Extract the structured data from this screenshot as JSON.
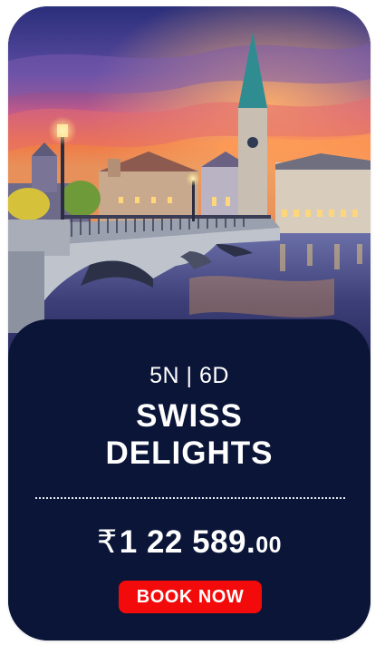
{
  "card": {
    "duration": "5N | 6D",
    "title_line1": "SWISS",
    "title_line2": "DELIGHTS",
    "price_currency": "₹",
    "price_main": "1 22 589.",
    "price_decimal": "00",
    "cta_label": "BOOK NOW"
  },
  "image": {
    "subject": "Zurich bridge over river at dusk with church spire"
  },
  "colors": {
    "panel": "#0b1538",
    "cta": "#f30a0a",
    "text": "#ffffff"
  }
}
